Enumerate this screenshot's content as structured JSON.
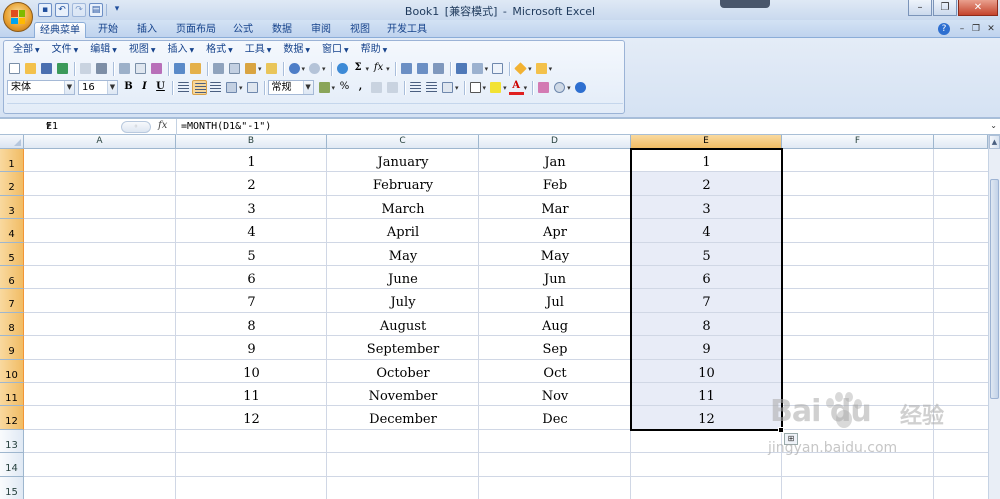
{
  "window": {
    "title_parts": [
      "Book1",
      "[兼容模式]",
      "-",
      "Microsoft Excel"
    ]
  },
  "ribbon_tabs": [
    "经典菜单",
    "开始",
    "插入",
    "页面布局",
    "公式",
    "数据",
    "审阅",
    "视图",
    "开发工具"
  ],
  "active_tab": "经典菜单",
  "classic_menu": [
    "全部",
    "文件",
    "编辑",
    "视图",
    "插入",
    "格式",
    "工具",
    "数据",
    "窗口",
    "帮助"
  ],
  "font": {
    "name": "宋体",
    "size": "16"
  },
  "number_format": "常规",
  "toolbar_glyphs": {
    "bold": "B",
    "italic": "I",
    "underline": "U",
    "sigma": "Σ",
    "fx": "fx",
    "percent": "%",
    "comma": ","
  },
  "formula_bar": {
    "name_box": "E1",
    "fx_label": "fx",
    "formula": "=MONTH(D1&\"-1\")"
  },
  "columns": [
    "A",
    "B",
    "C",
    "D",
    "E",
    "F"
  ],
  "selected_column": "E",
  "rows": [
    "1",
    "2",
    "3",
    "4",
    "5",
    "6",
    "7",
    "8",
    "9",
    "10",
    "11",
    "12",
    "13",
    "14",
    "15"
  ],
  "selected_rows": [
    "1",
    "2",
    "3",
    "4",
    "5",
    "6",
    "7",
    "8",
    "9",
    "10",
    "11",
    "12"
  ],
  "cells": {
    "B": [
      "1",
      "2",
      "3",
      "4",
      "5",
      "6",
      "7",
      "8",
      "9",
      "10",
      "11",
      "12"
    ],
    "C": [
      "January",
      "February",
      "March",
      "April",
      "May",
      "June",
      "July",
      "August",
      "September",
      "October",
      "November",
      "December"
    ],
    "D": [
      "Jan",
      "Feb",
      "Mar",
      "Apr",
      "May",
      "Jun",
      "Jul",
      "Aug",
      "Sep",
      "Oct",
      "Nov",
      "Dec"
    ],
    "E": [
      "1",
      "2",
      "3",
      "4",
      "5",
      "6",
      "7",
      "8",
      "9",
      "10",
      "11",
      "12"
    ]
  },
  "watermark": {
    "logo": "Bai du",
    "cn": "经验",
    "url": "jingyan.baidu.com"
  },
  "colors": {
    "selection_fill": "#e8ecf7",
    "header_selected": "#f1bc64",
    "gridline": "#d0d7e5"
  }
}
